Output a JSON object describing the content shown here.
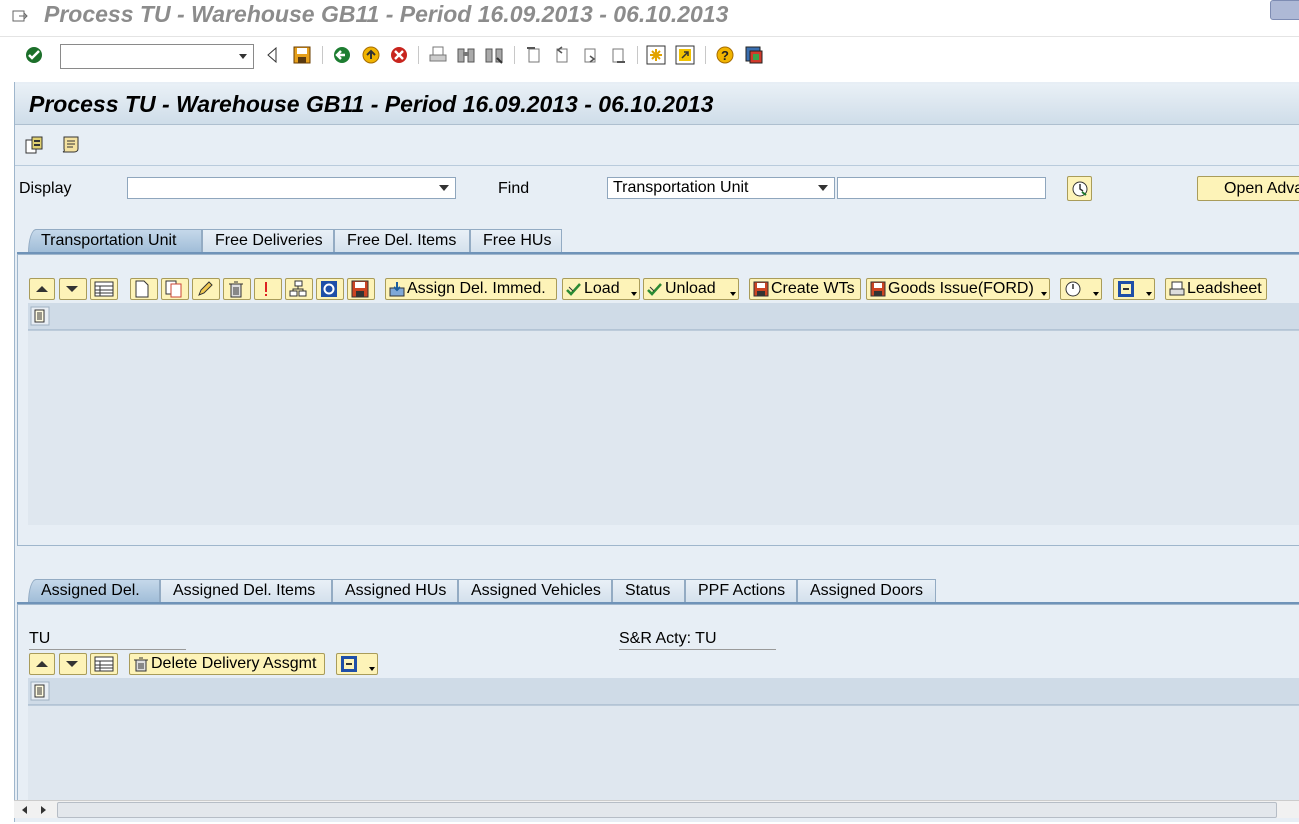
{
  "window": {
    "title": "Process TU - Warehouse GB11 - Period 16.09.2013 - 06.10.2013"
  },
  "system_toolbar": {
    "command_field_value": "",
    "icons": [
      "enter-icon",
      "back-nav-icon",
      "save-icon",
      "back-icon",
      "exit-icon",
      "cancel-icon",
      "print-icon",
      "find-icon",
      "find-next-icon",
      "first-page-icon",
      "prev-page-icon",
      "next-page-icon",
      "last-page-icon",
      "new-session-icon",
      "shortcut-icon",
      "help-icon",
      "customize-layout-icon"
    ]
  },
  "screen": {
    "title": "Process TU - Warehouse GB11 - Period 16.09.2013 - 06.10.2013"
  },
  "selection": {
    "display_label": "Display",
    "display_value": "",
    "find_label": "Find",
    "find_value": "Transportation Unit",
    "find_input_value": "",
    "open_adv_label": "Open Adva"
  },
  "top_tabs": [
    "Transportation Unit",
    "Free Deliveries",
    "Free Del. Items",
    "Free HUs"
  ],
  "top_toolbar": {
    "assign_label": "Assign Del. Immed.",
    "load_label": "Load",
    "unload_label": "Unload",
    "create_wts_label": "Create WTs",
    "goods_issue_label": "Goods Issue(FORD)",
    "leadsheet_label": "Leadsheet"
  },
  "bottom_tabs": [
    "Assigned Del.",
    "Assigned Del. Items",
    "Assigned HUs",
    "Assigned Vehicles",
    "Status",
    "PPF Actions",
    "Assigned Doors"
  ],
  "bottom": {
    "tu_label": "TU",
    "sr_label": "S&R Acty: TU",
    "delete_label": "Delete Delivery Assgmt"
  },
  "colors": {
    "accent": "#6f93b8",
    "button_yellow": "#fdf3b8",
    "panel_bg": "#e7eef5"
  }
}
